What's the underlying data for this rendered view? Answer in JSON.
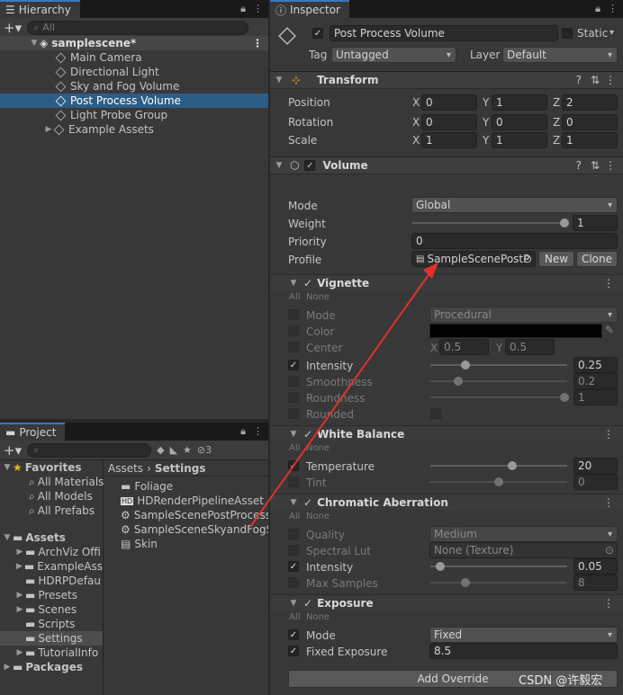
{
  "hierarchy": {
    "tab": "Hierarchy",
    "search_placeholder": "All",
    "scene": "samplescene*",
    "items": [
      "Main Camera",
      "Directional Light",
      "Sky and Fog Volume",
      "Post Process Volume",
      "Light Probe Group",
      "Example Assets"
    ],
    "selected_index": 3
  },
  "project": {
    "tab": "Project",
    "layer_count": "3",
    "favorites": {
      "label": "Favorites",
      "items": [
        "All Materials",
        "All Models",
        "All Prefabs"
      ]
    },
    "assets": {
      "label": "Assets",
      "items": [
        "ArchViz Offi",
        "ExampleAss",
        "HDRPDefau",
        "Presets",
        "Scenes",
        "Scripts",
        "Settings",
        "TutorialInfo"
      ]
    },
    "packages": "Packages",
    "selected_folder": "Settings",
    "breadcrumb": [
      "Assets",
      "Settings"
    ],
    "files": [
      "Foliage",
      "HDRenderPipelineAsset",
      "SampleScenePostProcess",
      "SampleSceneSkyandFogS",
      "Skin"
    ]
  },
  "inspector": {
    "tab": "Inspector",
    "object_name": "Post Process Volume",
    "static_label": "Static",
    "tag_label": "Tag",
    "tag_value": "Untagged",
    "layer_label": "Layer",
    "layer_value": "Default",
    "transform": {
      "title": "Transform",
      "position_label": "Position",
      "position": [
        "0",
        "1",
        "2"
      ],
      "rotation_label": "Rotation",
      "rotation": [
        "0",
        "0",
        "0"
      ],
      "scale_label": "Scale",
      "scale": [
        "1",
        "1",
        "1"
      ],
      "axes": [
        "X",
        "Y",
        "Z"
      ]
    },
    "volume": {
      "title": "Volume",
      "mode_label": "Mode",
      "mode_value": "Global",
      "weight_label": "Weight",
      "weight_value": "1",
      "priority_label": "Priority",
      "priority_value": "0",
      "profile_label": "Profile",
      "profile_value": "SampleScenePostP",
      "new_button": "New",
      "clone_button": "Clone"
    },
    "all_label": "All",
    "none_label": "None",
    "vignette": {
      "title": "Vignette",
      "mode_label": "Mode",
      "mode_value": "Procedural",
      "color_label": "Color",
      "center_label": "Center",
      "center_x": "0.5",
      "center_y": "0.5",
      "intensity_label": "Intensity",
      "intensity_value": "0.25",
      "smoothness_label": "Smoothness",
      "smoothness_value": "0.2",
      "roundness_label": "Roundness",
      "roundness_value": "1",
      "rounded_label": "Rounded"
    },
    "white_balance": {
      "title": "White Balance",
      "temperature_label": "Temperature",
      "temperature_value": "20",
      "tint_label": "Tint",
      "tint_value": "0"
    },
    "chromatic": {
      "title": "Chromatic Aberration",
      "quality_label": "Quality",
      "quality_value": "Medium",
      "lut_label": "Spectral Lut",
      "lut_value": "None (Texture)",
      "intensity_label": "Intensity",
      "intensity_value": "0.05",
      "samples_label": "Max Samples",
      "samples_value": "8"
    },
    "exposure": {
      "title": "Exposure",
      "mode_label": "Mode",
      "mode_value": "Fixed",
      "fixed_label": "Fixed Exposure",
      "fixed_value": "8.5"
    },
    "add_override": "Add Override"
  },
  "watermark": "CSDN @许毅宏",
  "colors": {
    "selection": "#2c5d87",
    "arrow": "#e0322b",
    "panel": "#383838"
  }
}
